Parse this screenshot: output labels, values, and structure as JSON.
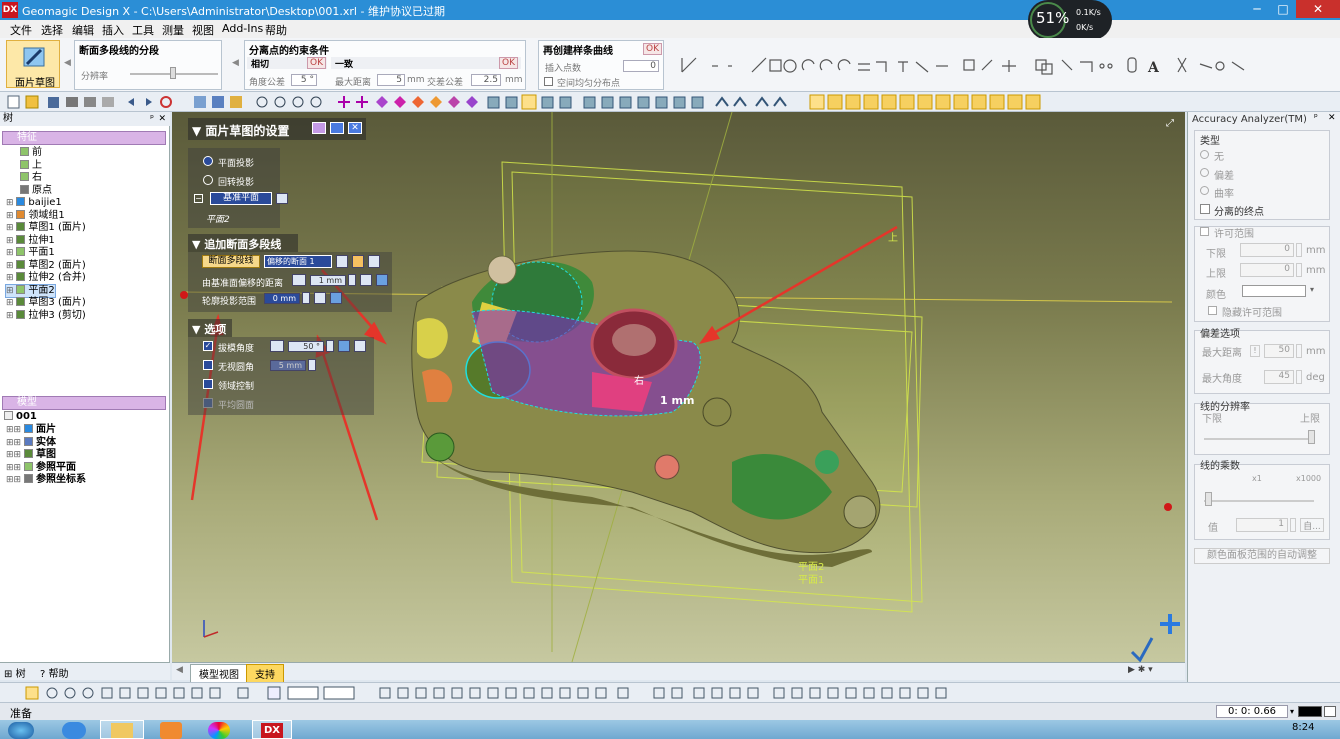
{
  "titlebar": {
    "logo": "DX",
    "title": "Geomagic Design X - C:\\Users\\Administrator\\Desktop\\001.xrl - 维护协议已过期",
    "minimize": "─",
    "maximize": "□",
    "close": "✕"
  },
  "netmon": {
    "percent": "51%",
    "up": "0.1K/s",
    "down": "0K/s"
  },
  "menu": [
    "文件",
    "选择",
    "编辑",
    "插入",
    "工具",
    "测量",
    "视图",
    "Add-Ins",
    "帮助"
  ],
  "ribbon": {
    "main_button": "面片草图",
    "group1": {
      "title": "断面多段线的分段",
      "field": "分辨率"
    },
    "group2": {
      "title": "分离点的约束条件",
      "tangent": "相切",
      "tangent_ok": "OK",
      "angle_label": "角度公差",
      "angle_value": "5 °",
      "consistent": "一致",
      "consistent_ok": "OK",
      "max_dist_label": "最大距离",
      "max_dist_value": "5",
      "max_dist_unit": "mm",
      "cross_label": "交差公差",
      "cross_value": "2.5",
      "cross_unit": "mm"
    },
    "group3": {
      "title": "再创建样条曲线",
      "ok": "OK",
      "insert_label": "插入点数",
      "insert_value": "0",
      "even_label": "空间均匀分布点"
    }
  },
  "tree_panel": {
    "header": "树",
    "features_title": "特征",
    "features": [
      {
        "label": "前",
        "indent": 1
      },
      {
        "label": "上",
        "indent": 1
      },
      {
        "label": "右",
        "indent": 1
      },
      {
        "label": "原点",
        "indent": 1
      },
      {
        "label": "baijie1",
        "indent": 2
      },
      {
        "label": "领域组1",
        "indent": 2
      },
      {
        "label": "草图1 (面片)",
        "indent": 2
      },
      {
        "label": "拉伸1",
        "indent": 2
      },
      {
        "label": "平面1",
        "indent": 2
      },
      {
        "label": "草图2 (面片)",
        "indent": 2
      },
      {
        "label": "拉伸2 (合并)",
        "indent": 2
      },
      {
        "label": "平面2",
        "indent": 2
      },
      {
        "label": "草图3 (面片)",
        "indent": 2
      },
      {
        "label": "拉伸3 (剪切)",
        "indent": 2
      }
    ],
    "model_title": "模型",
    "model_root": "001",
    "model_items": [
      "面片",
      "实体",
      "草图",
      "参照平面",
      "参照坐标系"
    ],
    "tabs": [
      "树",
      "帮助"
    ]
  },
  "overlay": {
    "title": "面片草图的设置",
    "plane_projection": "平面投影",
    "rotate_projection": "回转投影",
    "base_plane": "基准平面",
    "base_plane_value": "平面2",
    "section_title": "追加断面多段线",
    "poly_button": "断面多段线",
    "offset_select": "偏移的断面 1",
    "offset_dist_label": "由基准面偏移的距离",
    "offset_dist_value": "1 mm",
    "contour_label": "轮廓投影范围",
    "contour_value": "0 mm",
    "options_title": "选项",
    "draft_label": "拔模角度",
    "draft_value": "50 °",
    "nofillet_label": "无视圆角",
    "nofillet_value": "5 mm",
    "domain_label": "领域控制",
    "avg_label": "平均圆面"
  },
  "viewport": {
    "dimension": "1 mm",
    "label_right": "右",
    "label_up": "上",
    "plane2": "平面2",
    "plane1": "平面1",
    "tabs": [
      "模型视图",
      "支持"
    ]
  },
  "right_panel": {
    "header": "Accuracy Analyzer(TM)",
    "type_title": "类型",
    "type_options": [
      "无",
      "偏差",
      "曲率"
    ],
    "separated_end": "分离的终点",
    "tolerance_title": "许可范围",
    "lower": "下限",
    "lower_value": "0",
    "upper": "上限",
    "upper_value": "0",
    "unit_mm": "mm",
    "color": "颜色",
    "hide_range": "隐藏许可范围",
    "deviation_title": "偏差选项",
    "max_dist": "最大距离",
    "max_dist_value": "50",
    "max_angle": "最大角度",
    "max_angle_value": "45",
    "deg": "deg",
    "line_res_title": "线的分辨率",
    "res_low": "下限",
    "res_high": "上限",
    "line_mult_title": "线的乘数",
    "mult_min": "x1",
    "mult_max": "x1000",
    "value_label": "值",
    "value_value": "1",
    "auto": "自...",
    "auto_adjust": "颜色面板范围的自动调整"
  },
  "statusbar": {
    "text": "准备",
    "time": "0: 0: 0.66"
  },
  "taskbar": {
    "clock": "8:24",
    "dx": "DX"
  }
}
